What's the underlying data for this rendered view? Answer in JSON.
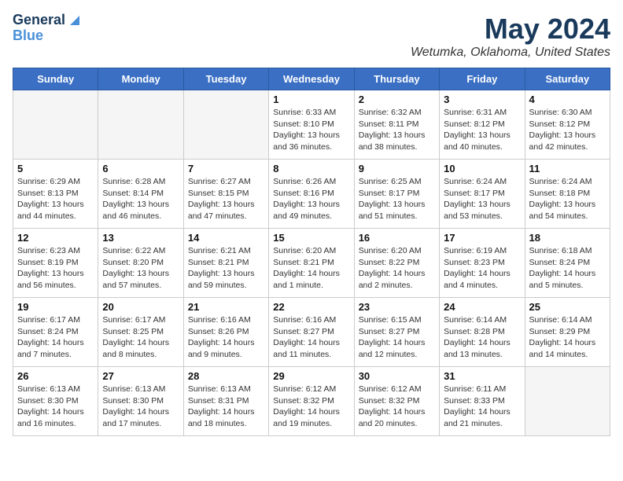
{
  "header": {
    "logo_line1": "General",
    "logo_line2": "Blue",
    "month_title": "May 2024",
    "location": "Wetumka, Oklahoma, United States"
  },
  "weekdays": [
    "Sunday",
    "Monday",
    "Tuesday",
    "Wednesday",
    "Thursday",
    "Friday",
    "Saturday"
  ],
  "weeks": [
    [
      {
        "day": "",
        "info": ""
      },
      {
        "day": "",
        "info": ""
      },
      {
        "day": "",
        "info": ""
      },
      {
        "day": "1",
        "info": "Sunrise: 6:33 AM\nSunset: 8:10 PM\nDaylight: 13 hours\nand 36 minutes."
      },
      {
        "day": "2",
        "info": "Sunrise: 6:32 AM\nSunset: 8:11 PM\nDaylight: 13 hours\nand 38 minutes."
      },
      {
        "day": "3",
        "info": "Sunrise: 6:31 AM\nSunset: 8:12 PM\nDaylight: 13 hours\nand 40 minutes."
      },
      {
        "day": "4",
        "info": "Sunrise: 6:30 AM\nSunset: 8:12 PM\nDaylight: 13 hours\nand 42 minutes."
      }
    ],
    [
      {
        "day": "5",
        "info": "Sunrise: 6:29 AM\nSunset: 8:13 PM\nDaylight: 13 hours\nand 44 minutes."
      },
      {
        "day": "6",
        "info": "Sunrise: 6:28 AM\nSunset: 8:14 PM\nDaylight: 13 hours\nand 46 minutes."
      },
      {
        "day": "7",
        "info": "Sunrise: 6:27 AM\nSunset: 8:15 PM\nDaylight: 13 hours\nand 47 minutes."
      },
      {
        "day": "8",
        "info": "Sunrise: 6:26 AM\nSunset: 8:16 PM\nDaylight: 13 hours\nand 49 minutes."
      },
      {
        "day": "9",
        "info": "Sunrise: 6:25 AM\nSunset: 8:17 PM\nDaylight: 13 hours\nand 51 minutes."
      },
      {
        "day": "10",
        "info": "Sunrise: 6:24 AM\nSunset: 8:17 PM\nDaylight: 13 hours\nand 53 minutes."
      },
      {
        "day": "11",
        "info": "Sunrise: 6:24 AM\nSunset: 8:18 PM\nDaylight: 13 hours\nand 54 minutes."
      }
    ],
    [
      {
        "day": "12",
        "info": "Sunrise: 6:23 AM\nSunset: 8:19 PM\nDaylight: 13 hours\nand 56 minutes."
      },
      {
        "day": "13",
        "info": "Sunrise: 6:22 AM\nSunset: 8:20 PM\nDaylight: 13 hours\nand 57 minutes."
      },
      {
        "day": "14",
        "info": "Sunrise: 6:21 AM\nSunset: 8:21 PM\nDaylight: 13 hours\nand 59 minutes."
      },
      {
        "day": "15",
        "info": "Sunrise: 6:20 AM\nSunset: 8:21 PM\nDaylight: 14 hours\nand 1 minute."
      },
      {
        "day": "16",
        "info": "Sunrise: 6:20 AM\nSunset: 8:22 PM\nDaylight: 14 hours\nand 2 minutes."
      },
      {
        "day": "17",
        "info": "Sunrise: 6:19 AM\nSunset: 8:23 PM\nDaylight: 14 hours\nand 4 minutes."
      },
      {
        "day": "18",
        "info": "Sunrise: 6:18 AM\nSunset: 8:24 PM\nDaylight: 14 hours\nand 5 minutes."
      }
    ],
    [
      {
        "day": "19",
        "info": "Sunrise: 6:17 AM\nSunset: 8:24 PM\nDaylight: 14 hours\nand 7 minutes."
      },
      {
        "day": "20",
        "info": "Sunrise: 6:17 AM\nSunset: 8:25 PM\nDaylight: 14 hours\nand 8 minutes."
      },
      {
        "day": "21",
        "info": "Sunrise: 6:16 AM\nSunset: 8:26 PM\nDaylight: 14 hours\nand 9 minutes."
      },
      {
        "day": "22",
        "info": "Sunrise: 6:16 AM\nSunset: 8:27 PM\nDaylight: 14 hours\nand 11 minutes."
      },
      {
        "day": "23",
        "info": "Sunrise: 6:15 AM\nSunset: 8:27 PM\nDaylight: 14 hours\nand 12 minutes."
      },
      {
        "day": "24",
        "info": "Sunrise: 6:14 AM\nSunset: 8:28 PM\nDaylight: 14 hours\nand 13 minutes."
      },
      {
        "day": "25",
        "info": "Sunrise: 6:14 AM\nSunset: 8:29 PM\nDaylight: 14 hours\nand 14 minutes."
      }
    ],
    [
      {
        "day": "26",
        "info": "Sunrise: 6:13 AM\nSunset: 8:30 PM\nDaylight: 14 hours\nand 16 minutes."
      },
      {
        "day": "27",
        "info": "Sunrise: 6:13 AM\nSunset: 8:30 PM\nDaylight: 14 hours\nand 17 minutes."
      },
      {
        "day": "28",
        "info": "Sunrise: 6:13 AM\nSunset: 8:31 PM\nDaylight: 14 hours\nand 18 minutes."
      },
      {
        "day": "29",
        "info": "Sunrise: 6:12 AM\nSunset: 8:32 PM\nDaylight: 14 hours\nand 19 minutes."
      },
      {
        "day": "30",
        "info": "Sunrise: 6:12 AM\nSunset: 8:32 PM\nDaylight: 14 hours\nand 20 minutes."
      },
      {
        "day": "31",
        "info": "Sunrise: 6:11 AM\nSunset: 8:33 PM\nDaylight: 14 hours\nand 21 minutes."
      },
      {
        "day": "",
        "info": ""
      }
    ]
  ]
}
